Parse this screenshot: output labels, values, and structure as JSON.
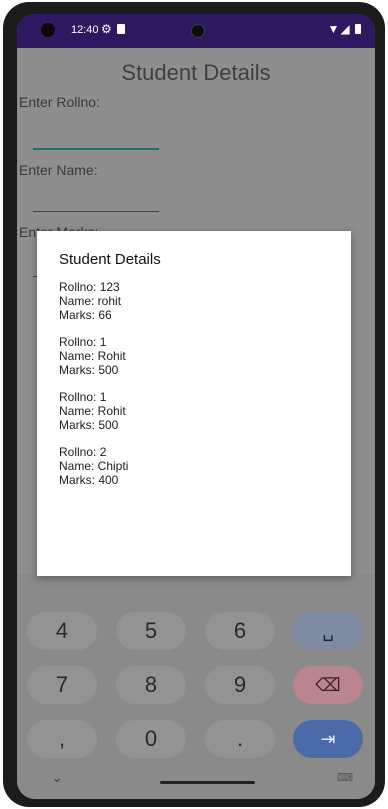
{
  "status_bar": {
    "time": "12:40",
    "settings_icon": "⚙",
    "right_icons": "▼◢"
  },
  "app": {
    "title": "Student Details",
    "rollno_label": "Enter Rollno:",
    "name_label": "Enter Name:",
    "marks_label": "Enter Marks:"
  },
  "dialog": {
    "title": "Student Details",
    "records": [
      {
        "rollno": "Rollno: 123",
        "name": "Name: rohit",
        "marks": "Marks: 66"
      },
      {
        "rollno": "Rollno: 1",
        "name": "Name: Rohit",
        "marks": "Marks: 500"
      },
      {
        "rollno": "Rollno: 1",
        "name": "Name: Rohit",
        "marks": "Marks: 500"
      },
      {
        "rollno": "Rollno: 2",
        "name": "Name: Chipti",
        "marks": "Marks: 400"
      }
    ]
  },
  "keyboard": {
    "row1": [
      "4",
      "5",
      "6",
      "␣"
    ],
    "row2": [
      "7",
      "8",
      "9",
      "⌫"
    ],
    "row3": [
      ",",
      "0",
      ".",
      "⇥"
    ],
    "chevron": "⌄",
    "keyboard_icon": "⌨"
  },
  "colors": {
    "status_bar": "#2c1960",
    "accent_underline": "#1f6f6c",
    "enter_key": "#4a6aa8",
    "delete_key": "#b9868e"
  }
}
